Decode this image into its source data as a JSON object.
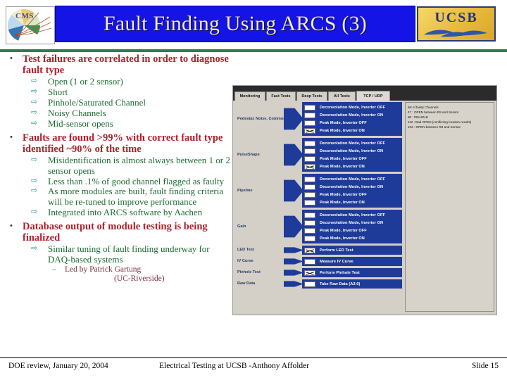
{
  "header": {
    "title": "Fault Finding Using ARCS (3)",
    "cms_logo_text": "CMS",
    "ucsb_logo_text": "UCSB"
  },
  "content": {
    "bullets": [
      {
        "text": "Test failures are correlated in order to diagnose fault type",
        "children": [
          {
            "text": "Open (1 or 2 sensor)"
          },
          {
            "text": "Short"
          },
          {
            "text": "Pinhole/Saturated Channel"
          },
          {
            "text": "Noisy Channels"
          },
          {
            "text": "Mid-sensor opens"
          }
        ]
      },
      {
        "text": "Faults are found >99% with correct fault type identified ~90% of the time",
        "children": [
          {
            "text": "Misidentification is almost always between 1 or 2 sensor opens"
          },
          {
            "text": "Less than .1% of good channel flagged as faulty"
          },
          {
            "text": "As more modules are built, fault finding criteria will be re-tuned to improve performance"
          },
          {
            "text": "Integrated into ARCS software by Aachen"
          }
        ]
      },
      {
        "text": "Database output of module testing is being finalized",
        "children": [
          {
            "text": "Similar tuning of fault finding underway for DAQ-based systems",
            "subchildren": [
              {
                "text": "Led by Patrick Gartung",
                "tail": "(UC-Riverside)"
              }
            ]
          }
        ]
      }
    ]
  },
  "app": {
    "tabs": [
      {
        "label": "Monitoring",
        "active": false
      },
      {
        "label": "Fast Tests",
        "active": false
      },
      {
        "label": "Deep Tests",
        "active": false
      },
      {
        "label": "All Tests",
        "active": false
      },
      {
        "label": "TCP / UDP",
        "active": true
      }
    ],
    "groups": [
      {
        "name": "Pedestal, Noise, Common Mode",
        "rows": [
          {
            "label": "Deconvolution Mode, Inverter OFF",
            "checked": false
          },
          {
            "label": "Deconvolution Mode, Inverter ON",
            "checked": false
          },
          {
            "label": "Peak Mode, Inverter OFF",
            "checked": false
          },
          {
            "label": "Peak Mode, Inverter ON",
            "checked": true
          }
        ]
      },
      {
        "name": "PulseShape",
        "rows": [
          {
            "label": "Deconvolution Mode, Inverter OFF",
            "checked": false
          },
          {
            "label": "Deconvolution Mode, Inverter ON",
            "checked": false
          },
          {
            "label": "Peak Mode, Inverter OFF",
            "checked": false
          },
          {
            "label": "Peak Mode, Inverter ON",
            "checked": true
          }
        ]
      },
      {
        "name": "Pipeline",
        "rows": [
          {
            "label": "Deconvolution Mode, Inverter OFF",
            "checked": false
          },
          {
            "label": "Deconvolution Mode, Inverter ON",
            "checked": false
          },
          {
            "label": "Peak Mode, Inverter OFF",
            "checked": false
          },
          {
            "label": "Peak Mode, Inverter ON",
            "checked": false
          }
        ]
      },
      {
        "name": "Gain",
        "rows": [
          {
            "label": "Deconvolution Mode, Inverter OFF",
            "checked": false
          },
          {
            "label": "Deconvolution Mode, Inverter ON",
            "checked": false
          },
          {
            "label": "Peak Mode, Inverter OFF",
            "checked": false
          },
          {
            "label": "Peak Mode, Inverter ON",
            "checked": false
          }
        ]
      },
      {
        "name": "LED Test",
        "rows": [
          {
            "label": "Perform LED Test",
            "checked": true
          }
        ]
      },
      {
        "name": "IV Curve",
        "rows": [
          {
            "label": "Measure IV Curve",
            "checked": false
          }
        ]
      },
      {
        "name": "Pinhole Test",
        "rows": [
          {
            "label": "Perform Pinhole Test",
            "checked": true
          }
        ]
      },
      {
        "name": "Raw Data",
        "rows": [
          {
            "label": "Take Raw Data (A3:0)",
            "checked": false
          }
        ]
      }
    ],
    "results_panel": {
      "lines": [
        "list of faulty Channels",
        "47 : OPEN between R8 and Sensor",
        "90 : PINHOLE",
        "112 : Bad OPEN (conflicting location results)",
        "242 : OPEN between R8 and Sensor"
      ]
    }
  },
  "footer": {
    "left": "DOE review, January 20, 2004",
    "center": "Electrical Testing at UCSB -Anthony Affolder",
    "right": "Slide 15"
  }
}
